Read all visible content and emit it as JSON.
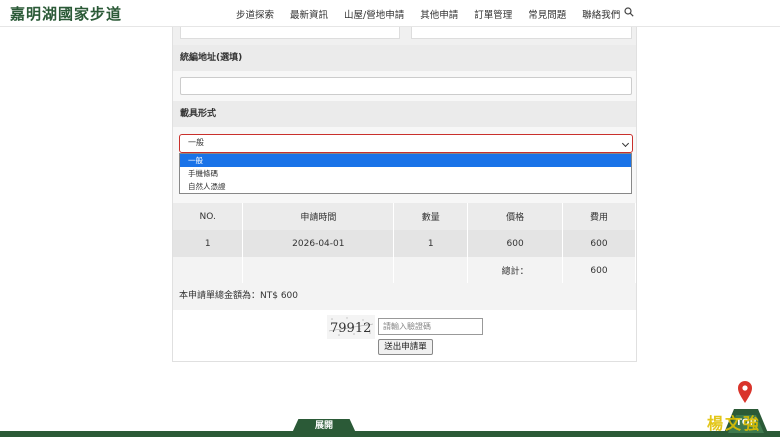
{
  "header": {
    "logo_text": "嘉明湖國家步道",
    "nav": [
      "步道探索",
      "最新資訊",
      "山屋/營地申請",
      "其他申請",
      "訂單管理",
      "常見問題",
      "聯絡我們"
    ]
  },
  "form": {
    "invoice_address_label": "統編地址(選填)",
    "invoice_address_value": "",
    "carrier_label": "載具形式",
    "carrier_selected": "一般",
    "carrier_options": [
      "一般",
      "手機條碼",
      "自然人憑證"
    ]
  },
  "order_table": {
    "headers": [
      "NO.",
      "申請時間",
      "數量",
      "價格",
      "費用"
    ],
    "rows": [
      [
        "1",
        "2026-04-01",
        "1",
        "600",
        "600"
      ]
    ],
    "subtotal_label": "總計：",
    "subtotal_value": "600"
  },
  "total_text": "本申請單總金額為：NT$ 600",
  "captcha": {
    "image_text": "79912",
    "placeholder": "請輸入驗證碼",
    "submit_label": "送出申請單"
  },
  "footer": {
    "expand_label": "展開",
    "top_label": "TOP"
  },
  "colors": {
    "brand": "#2b5a37",
    "error_border": "#c9302c",
    "selected_option": "#1a73e8"
  }
}
